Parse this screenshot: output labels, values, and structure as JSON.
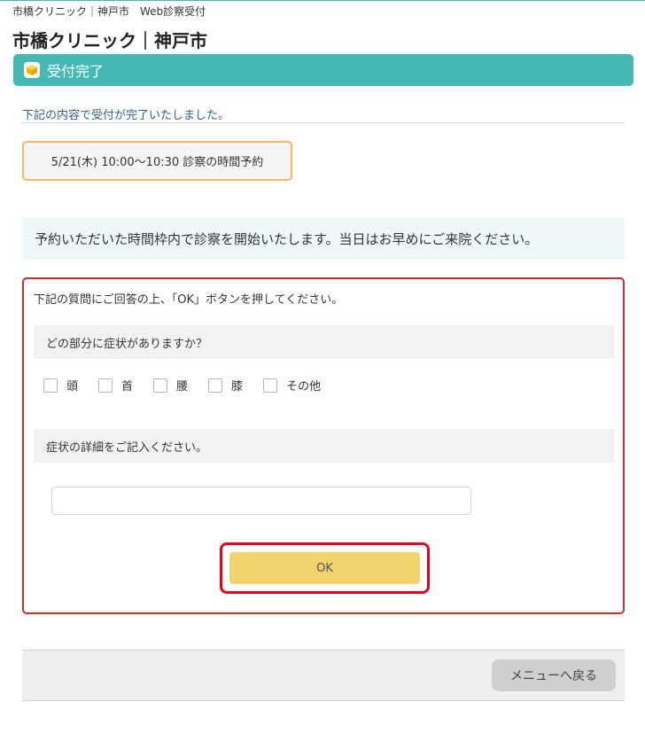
{
  "header": {
    "breadcrumb": "市橋クリニック｜神戸市　Web診察受付",
    "site_title": "市橋クリニック｜神戸市"
  },
  "banner": {
    "icon": "cube-icon",
    "title": "受付完了",
    "color": "#45bab4"
  },
  "notice": "下記の内容で受付が完了いたしました。",
  "reservation": {
    "text": "5/21(木) 10:00〜10:30 診察の時間予約"
  },
  "info": "予約いただいた時間枠内で診察を開始いたします。当日はお早めにご来院ください。",
  "form": {
    "instruction": "下記の質問にご回答の上、「OK」ボタンを押してください。",
    "question1": "どの部分に症状がありますか？",
    "options": [
      "頭",
      "首",
      "腰",
      "膝",
      "その他"
    ],
    "question2": "症状の詳細をご記入ください。",
    "detail_value": "",
    "ok_label": "OK"
  },
  "footer": {
    "menu_label": "メニューへ戻る"
  }
}
